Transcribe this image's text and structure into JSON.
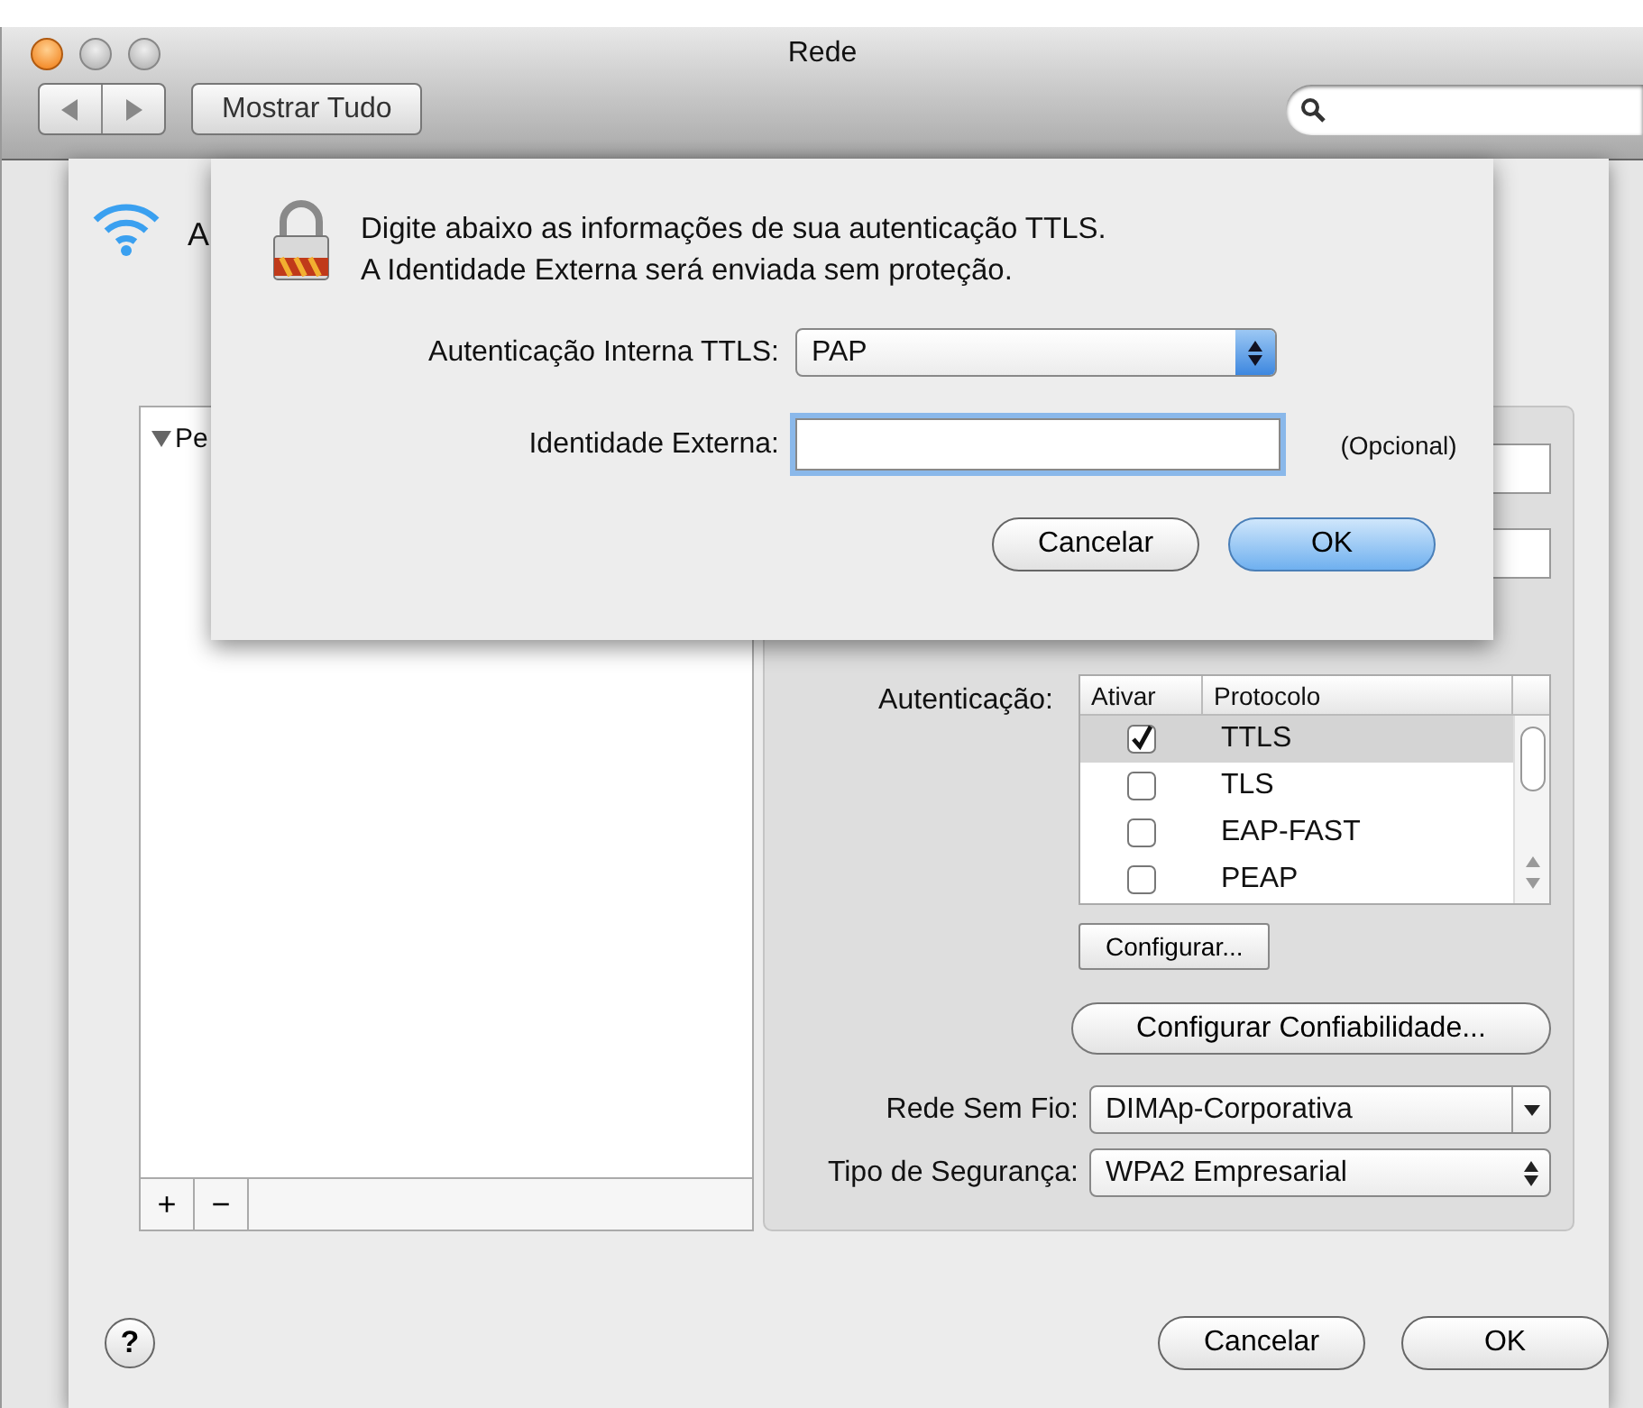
{
  "window": {
    "title": "Rede",
    "show_all_button": "Mostrar Tudo"
  },
  "background": {
    "service_name": "A"
  },
  "sheet": {
    "profiles": {
      "group": "Pe",
      "expanded": true
    },
    "list_buttons": [
      "+",
      "−"
    ],
    "auth_label": "Autenticação:",
    "columns": [
      "Ativar",
      "Protocolo"
    ],
    "protocols": [
      {
        "name": "TTLS",
        "checked": true,
        "selected": true
      },
      {
        "name": "TLS",
        "checked": false,
        "selected": false
      },
      {
        "name": "EAP-FAST",
        "checked": false,
        "selected": false
      },
      {
        "name": "PEAP",
        "checked": false,
        "selected": false
      }
    ],
    "configure_button": "Configurar...",
    "trust_button": "Configurar Confiabilidade...",
    "wireless_network": {
      "label": "Rede Sem Fio:",
      "value": "DIMAp-Corporativa"
    },
    "security_type": {
      "label": "Tipo de Segurança:",
      "value": "WPA2 Empresarial"
    },
    "help_button": "?",
    "buttons": [
      {
        "label": "Cancelar",
        "default": false
      },
      {
        "label": "OK",
        "default": false
      }
    ]
  },
  "dialog": {
    "message": [
      "Digite abaixo as informações de sua autenticação TTLS.",
      "A Identidade Externa será enviada sem proteção."
    ],
    "inner_auth": {
      "label": "Autenticação Interna TTLS:",
      "value": "PAP"
    },
    "outer_identity": {
      "label": "Identidade Externa:",
      "hint": "(Opcional)",
      "focused": true
    },
    "buttons": [
      {
        "label": "Cancelar",
        "default": false
      },
      {
        "label": "OK",
        "default": true
      }
    ]
  }
}
